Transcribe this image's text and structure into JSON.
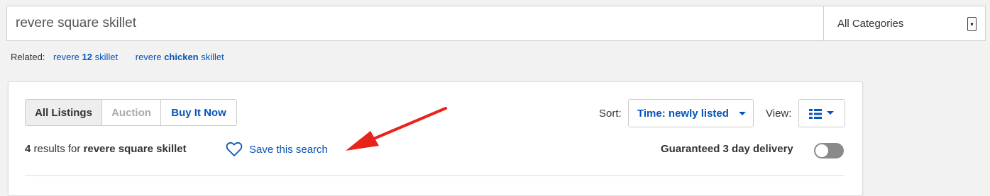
{
  "search": {
    "query": "revere square skillet",
    "category": "All Categories"
  },
  "related": {
    "label": "Related:",
    "links": [
      {
        "prefix": "revere ",
        "bold": "12",
        "suffix": " skillet"
      },
      {
        "prefix": "revere ",
        "bold": "chicken",
        "suffix": " skillet"
      }
    ]
  },
  "tabs": [
    {
      "label": "All Listings",
      "state": "selected"
    },
    {
      "label": "Auction",
      "state": "disabled"
    },
    {
      "label": "Buy It Now",
      "state": "link"
    }
  ],
  "sort": {
    "label": "Sort:",
    "value": "Time: newly listed"
  },
  "view": {
    "label": "View:",
    "icon": "list-view-icon"
  },
  "results": {
    "count": "4",
    "mid": " results for ",
    "query": "revere square skillet"
  },
  "save_search": {
    "label": "Save this search",
    "icon": "heart-icon"
  },
  "delivery": {
    "label": "Guaranteed 3 day delivery",
    "toggle_on": false
  },
  "annotation": {
    "arrow_color": "#e8231c"
  },
  "colors": {
    "link": "#0654ba",
    "background": "#f2f2f2"
  }
}
